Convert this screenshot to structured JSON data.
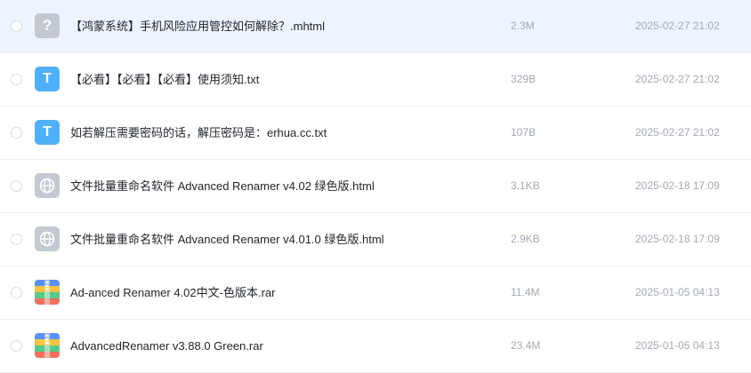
{
  "files": [
    {
      "icon": "unknown-file-icon",
      "icon_glyph": "?",
      "name": "【鸿蒙系统】手机风险应用管控如何解除？.mhtml",
      "size": "2.3M",
      "date": "2025-02-27 21:02",
      "selected": true
    },
    {
      "icon": "text-file-icon",
      "icon_glyph": "T",
      "name": "【必看】【必看】【必看】使用须知.txt",
      "size": "329B",
      "date": "2025-02-27 21:02"
    },
    {
      "icon": "text-file-icon",
      "icon_glyph": "T",
      "name": "如若解压需要密码的话，解压密码是：erhua.cc.txt",
      "size": "107B",
      "date": "2025-02-27 21:02"
    },
    {
      "icon": "web-file-icon",
      "icon_glyph": "",
      "name": "文件批量重命名软件 Advanced Renamer v4.02 绿色版.html",
      "size": "3.1KB",
      "date": "2025-02-18 17:09"
    },
    {
      "icon": "web-file-icon",
      "icon_glyph": "",
      "name": "文件批量重命名软件 Advanced Renamer v4.01.0 绿色版.html",
      "size": "2.9KB",
      "date": "2025-02-18 17:09"
    },
    {
      "icon": "archive-file-icon",
      "icon_glyph": "",
      "name": "Ad-anced Renamer 4.02中文-色版本.rar",
      "size": "11.4M",
      "date": "2025-01-05 04:13"
    },
    {
      "icon": "archive-file-icon",
      "icon_glyph": "",
      "name": "AdvancedRenamer v3.88.0 Green.rar",
      "size": "23.4M",
      "date": "2025-01-05 04:13"
    }
  ],
  "colors": {
    "selected_row": "#eef4ff",
    "text_primary": "#1f2329",
    "text_secondary": "#a3a8b3",
    "txt_icon": "#4fb0f7",
    "generic_icon": "#c4c8d0"
  }
}
